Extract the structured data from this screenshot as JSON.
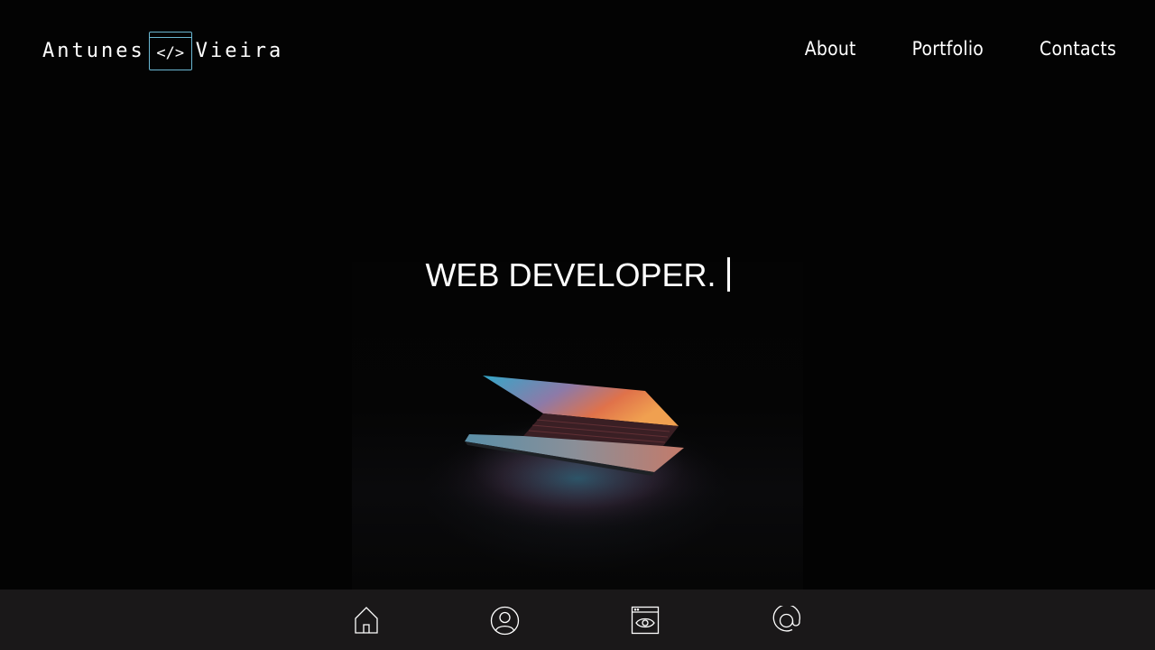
{
  "brand": {
    "left_word": "Antunes",
    "mark": "</>",
    "right_word": "Vieira",
    "accent_color": "#6ab7d2"
  },
  "nav": {
    "about": "About",
    "portfolio": "Portfolio",
    "contacts": "Contacts"
  },
  "hero": {
    "headline": "WEB DEVELOPER.",
    "image": "laptop-in-dark-photo"
  },
  "bottom_nav": {
    "icons": [
      "home-icon",
      "profile-icon",
      "portfolio-icon",
      "contact-at-icon"
    ]
  },
  "colors": {
    "background": "#030303",
    "bottom_bar": "#1a1819",
    "text": "#ffffff"
  }
}
